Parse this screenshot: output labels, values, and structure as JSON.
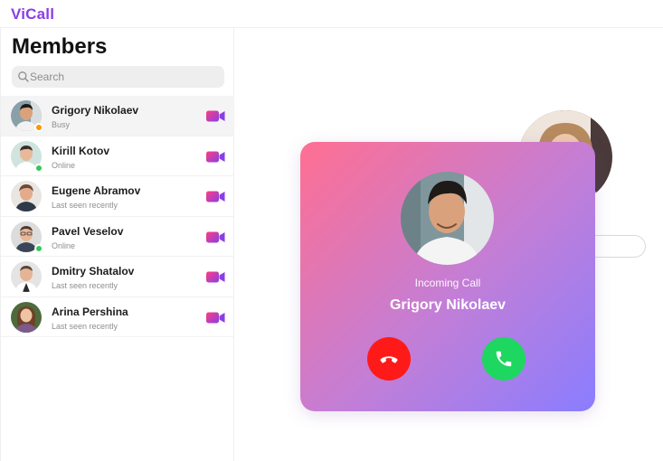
{
  "app": {
    "brand": "ViCall"
  },
  "sidebar": {
    "title": "Members",
    "search_placeholder": "Search",
    "members": [
      {
        "name": "Grigory Nikolaev",
        "status": "Busy",
        "status_color": "#ff9500",
        "selected": true
      },
      {
        "name": "Kirill Kotov",
        "status": "Online",
        "status_color": "#34c759"
      },
      {
        "name": "Eugene Abramov",
        "status": "Last seen recently"
      },
      {
        "name": "Pavel Veselov",
        "status": "Online",
        "status_color": "#34c759"
      },
      {
        "name": "Dmitry Shatalov",
        "status": "Last seen recently"
      },
      {
        "name": "Arina Pershina",
        "status": "Last seen recently"
      }
    ]
  },
  "call": {
    "label": "Incoming Call",
    "caller_name": "Grigory Nikolaev",
    "decline_color": "#ff1a1a",
    "accept_color": "#1ed760"
  },
  "colors": {
    "brand": "#8a3ee6",
    "video_gradient_start": "#ff3d7f",
    "video_gradient_end": "#8a3ee6",
    "card_gradient": [
      "#ff6f92",
      "#c27ed7",
      "#8a7dff"
    ]
  }
}
